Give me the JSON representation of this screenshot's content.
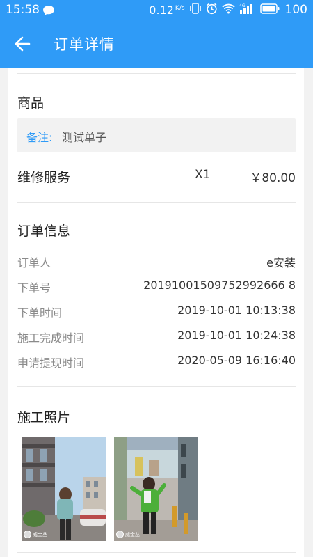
{
  "status_bar": {
    "time": "15:58",
    "speed": "0.12",
    "speed_unit": "K/s",
    "battery": "100",
    "network": "4G"
  },
  "app_bar": {
    "title": "订单详情"
  },
  "goods": {
    "title": "商品",
    "note_label": "备注:",
    "note_text": "测试单子",
    "item_name": "维修服务",
    "item_qty": "X1",
    "item_price": "￥80.00"
  },
  "order_info": {
    "title": "订单信息",
    "rows": [
      {
        "label": "订单人",
        "value": "e安装"
      },
      {
        "label": "下单号",
        "value": "20191001509752992666 8"
      },
      {
        "label": "下单时间",
        "value": "2019-10-01 10:13:38"
      },
      {
        "label": "施工完成时间",
        "value": "2019-10-01 10:24:38"
      },
      {
        "label": "申请提现时间",
        "value": "2020-05-09 16:16:40"
      }
    ]
  },
  "photos": {
    "title": "施工照片",
    "items": [
      {
        "watermark": "威金丛"
      },
      {
        "watermark": "威金丛"
      }
    ]
  },
  "colors": {
    "primary": "#2f9bf7",
    "note_bg": "#f2f2f2"
  }
}
